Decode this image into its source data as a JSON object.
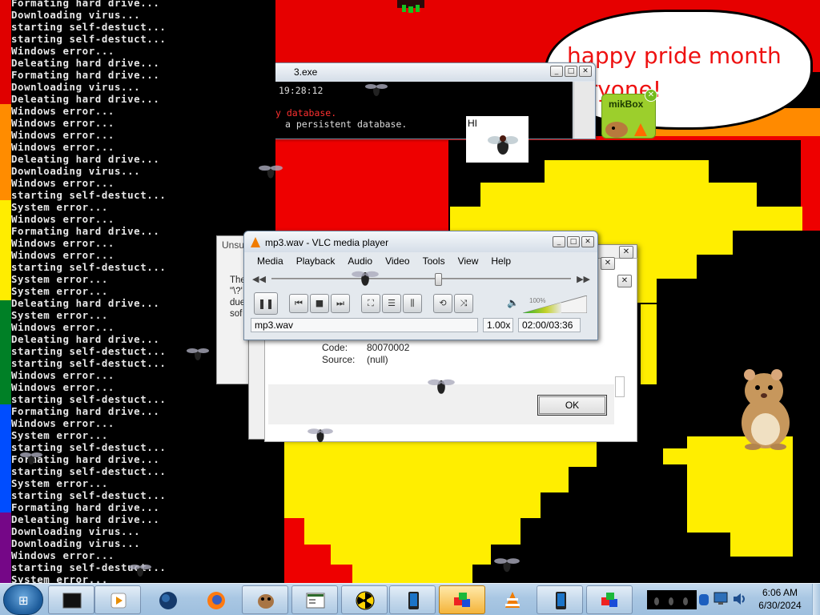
{
  "console": {
    "lines": [
      "Formating hard drive...",
      "Downloading virus...",
      "starting self-destuct...",
      "starting self-destuct...",
      "Windows error...",
      "Deleating hard drive...",
      "Formating hard drive...",
      "Downloading virus...",
      "Deleating hard drive...",
      "Windows error...",
      "Windows error...",
      "Windows error...",
      "Windows error...",
      "Deleating hard drive...",
      "Downloading virus...",
      "Windows error...",
      "starting self-destuct...",
      "System error...",
      "Windows error...",
      "Formating hard drive...",
      "Windows error...",
      "Windows error...",
      "starting self-destuct...",
      "System error...",
      "System error...",
      "Deleating hard drive...",
      "System error...",
      "Windows error...",
      "Deleating hard drive...",
      "starting self-destuct...",
      "starting self-destuct...",
      "Windows error...",
      "Windows error...",
      "starting self-destuct...",
      "Formating hard drive...",
      "Windows error...",
      "System error...",
      "starting self-destuct...",
      "Formating hard drive...",
      "starting self-destuct...",
      "System error...",
      "starting self-destuct...",
      "Formating hard drive...",
      "Deleating hard drive...",
      "Downloading virus...",
      "Downloading virus...",
      "Windows error...",
      "starting self-destuct...",
      "System error..."
    ]
  },
  "exe_window": {
    "title": "3.exe",
    "lines": [
      "19:28:12",
      "",
      "y database.",
      "a persistent database."
    ],
    "buttons": {
      "minimize": "_",
      "maximize": "□",
      "close": "✕"
    }
  },
  "speech_bubble": {
    "text": "happy pride month\n   ryone!"
  },
  "hi_card": {
    "text": "HI"
  },
  "mikbox": {
    "label": "mikBox",
    "close": "✕"
  },
  "error_dialog": {
    "title_fragment": "Unsu",
    "body_fragment": "The\n\"\\?'\ndue\nsof",
    "code_label": "Code:",
    "code_value": "80070002",
    "source_label": "Source:",
    "source_value": "(null)",
    "ok_label": "OK",
    "close_glyph": "✕"
  },
  "vlc": {
    "title": "mp3.wav - VLC media player",
    "menu": [
      "Media",
      "Playback",
      "Audio",
      "Video",
      "Tools",
      "View",
      "Help"
    ],
    "controls": {
      "pause": "❚❚",
      "prev": "⏮",
      "stop": "■",
      "next": "⏭",
      "fullscreen": "⛶",
      "playlist": "☰",
      "extended": "⫼",
      "loop": "⟲",
      "shuffle": "⤨"
    },
    "seek_back": "◀◀",
    "seek_fwd": "▶▶",
    "volume_icon": "🔈",
    "volume_percent": "100%",
    "volume_level": 1.0,
    "position_fraction": 0.5556,
    "status": {
      "filename": "mp3.wav",
      "speed": "1.00x",
      "time": "02:00/03:36"
    },
    "buttons": {
      "minimize": "_",
      "maximize": "□",
      "close": "✕"
    }
  },
  "taskbar": {
    "items": [
      "console-window",
      "media-player",
      "globe",
      "firefox",
      "chipmunk",
      "spreadsheet",
      "radiation",
      "phone",
      "cube-active",
      "vlc-cone",
      "phone",
      "cube"
    ],
    "clock_time": "6:06 AM",
    "clock_date": "6/30/2024"
  },
  "colors": {
    "accent_red": "#ee0000",
    "pac_yellow": "#ffee00",
    "vlc_orange": "#f07c00"
  }
}
